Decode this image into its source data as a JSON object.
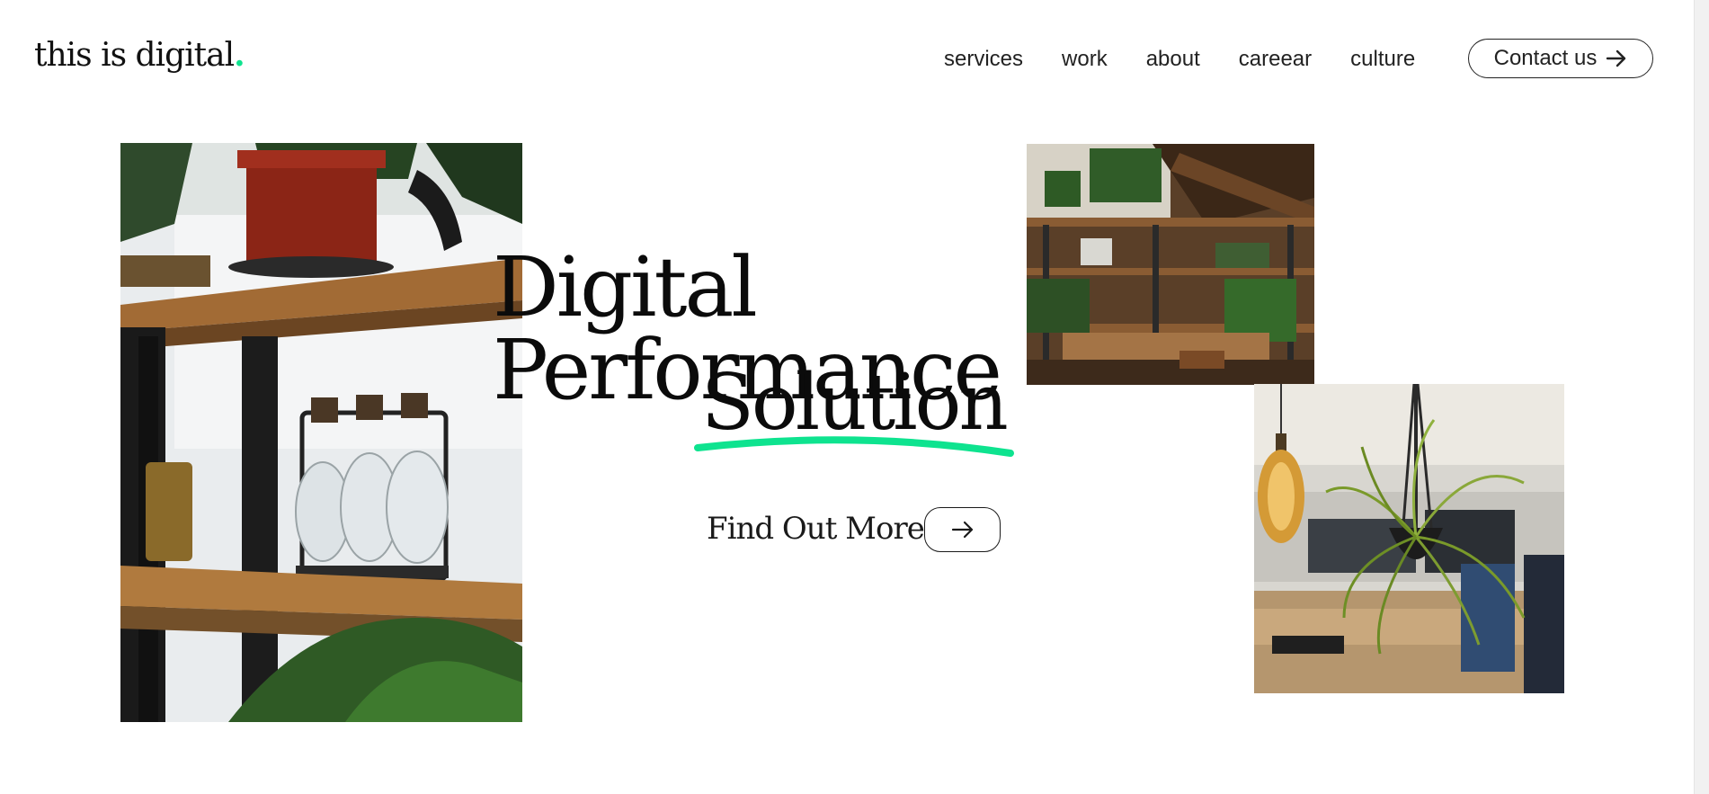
{
  "brand": {
    "name": "this is digital",
    "dot": ".",
    "accent": "#0ee38f"
  },
  "nav": {
    "items": [
      "services",
      "work",
      "about",
      "careear",
      "culture"
    ],
    "contact_label": "Contact us",
    "contact_icon": "arrow-right-icon"
  },
  "hero": {
    "headline_line1": "Digital Performance",
    "headline_line2": "Solution",
    "cta_label": "Find Out More",
    "cta_icon": "arrow-right-icon"
  },
  "images": [
    {
      "name": "plant-shelf-photo"
    },
    {
      "name": "office-shelves-photo"
    },
    {
      "name": "hanging-plant-photo"
    }
  ]
}
